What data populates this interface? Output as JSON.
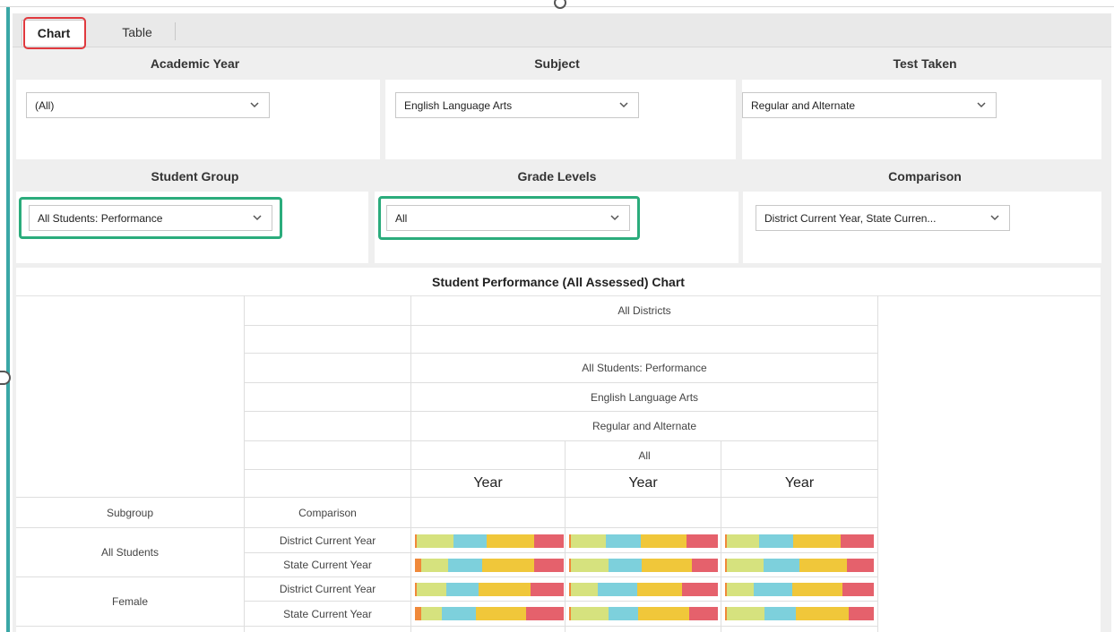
{
  "tabs": {
    "chart": "Chart",
    "table": "Table"
  },
  "filters": {
    "academic_year": {
      "label": "Academic Year",
      "value": "(All)"
    },
    "subject": {
      "label": "Subject",
      "value": "English Language Arts"
    },
    "test_taken": {
      "label": "Test Taken",
      "value": "Regular and Alternate"
    },
    "student_group": {
      "label": "Student Group",
      "value": "All Students: Performance"
    },
    "grade_levels": {
      "label": "Grade Levels",
      "value": "All"
    },
    "comparison": {
      "label": "Comparison",
      "value": "District Current Year, State Curren..."
    }
  },
  "chart": {
    "title": "Student Performance (All Assessed) Chart",
    "header_rows": [
      "All Districts",
      "",
      "All Students: Performance",
      "English Language Arts",
      "Regular and Alternate",
      "All"
    ],
    "column_labels": [
      "Year",
      "Year",
      "Year"
    ],
    "row_headers": {
      "subgroup": "Subgroup",
      "comparison": "Comparison"
    },
    "rows": [
      {
        "subgroup": "All Students",
        "comparisons": [
          "District Current Year",
          "State Current Year"
        ]
      },
      {
        "subgroup": "Female",
        "comparisons": [
          "District Current Year",
          "State Current Year"
        ]
      }
    ],
    "colors": {
      "level1": "#f0893a",
      "level2": "#d6e27e",
      "level3": "#7dd0dc",
      "level4": "#f0c73a",
      "level5": "#e5616c"
    }
  },
  "chart_data": {
    "type": "bar",
    "stacked": true,
    "orientation": "horizontal",
    "title": "Student Performance (All Assessed) Chart",
    "categories": [
      "All Students / District Current Year",
      "All Students / State Current Year",
      "Female / District Current Year",
      "Female / State Current Year"
    ],
    "columns": [
      "Year",
      "Year",
      "Year"
    ],
    "series_colors": [
      "#f0893a",
      "#d6e27e",
      "#7dd0dc",
      "#f0c73a",
      "#e5616c"
    ],
    "panels": [
      [
        [
          1,
          25,
          22,
          32,
          20
        ],
        [
          4,
          18,
          23,
          35,
          20
        ],
        [
          1,
          20,
          22,
          35,
          22
        ],
        [
          4,
          14,
          23,
          34,
          25
        ]
      ],
      [
        [
          1,
          24,
          23,
          31,
          21
        ],
        [
          1,
          26,
          23,
          35,
          18
        ],
        [
          1,
          18,
          27,
          30,
          24
        ],
        [
          1,
          26,
          21,
          35,
          20
        ]
      ],
      [
        [
          1,
          22,
          23,
          32,
          22
        ],
        [
          1,
          25,
          24,
          32,
          18
        ],
        [
          1,
          18,
          26,
          34,
          21
        ],
        [
          1,
          26,
          21,
          36,
          17
        ]
      ]
    ]
  }
}
